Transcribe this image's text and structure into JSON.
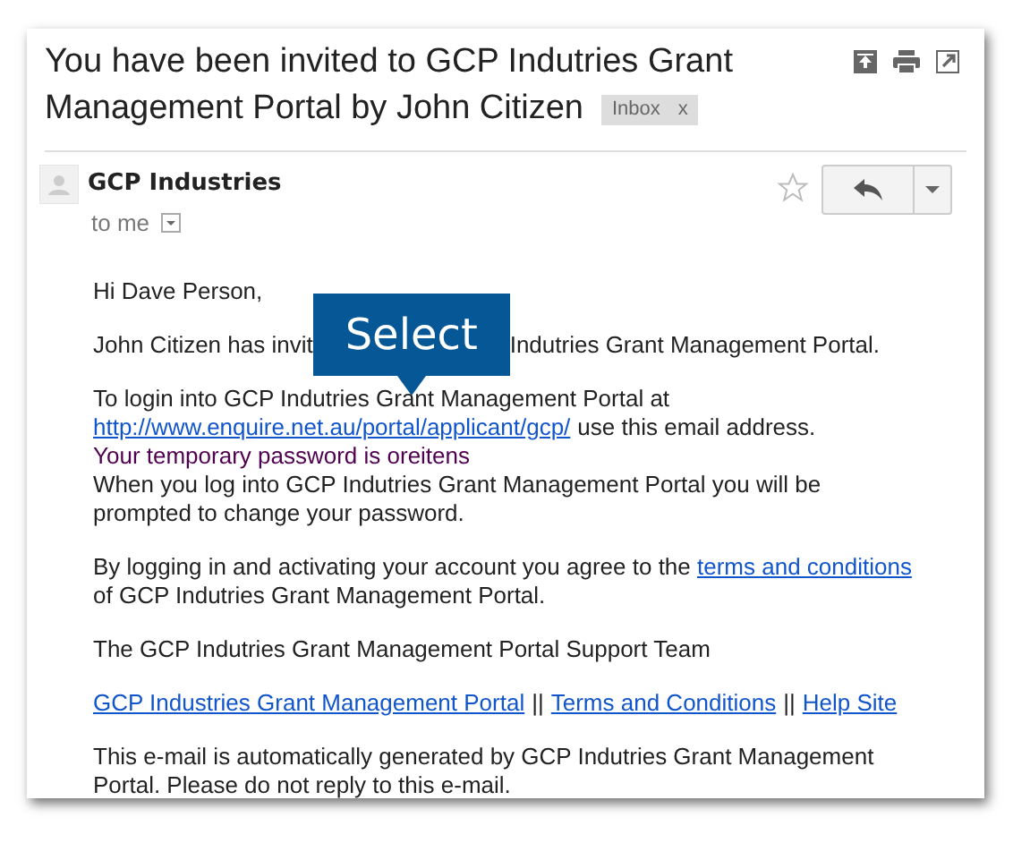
{
  "email": {
    "subject_lines": [
      "You have been invited to GCP Indutries Grant",
      "Management Portal by John Citizen"
    ],
    "label": {
      "text": "Inbox",
      "remove": "x"
    }
  },
  "sender": {
    "name": "GCP Industries",
    "recipient": "to me",
    "starred": false
  },
  "body": {
    "greeting": "Hi Dave Person,",
    "invite_visible": [
      "John Citizen has invit",
      "Indutries Grant Management Portal."
    ],
    "callout": "Select",
    "login_line": "To login into GCP Indutries Grant Management Portal at",
    "login_link": "http://www.enquire.net.au/portal/applicant/gcp/",
    "login_after": "use this email address.",
    "password": "Your temporary password is oreitens",
    "change": "When you log into GCP Indutries Grant Management Portal you will be prompted to change your password.",
    "agree": "By logging in and activating your account you agree to the",
    "agree_link": "terms and conditions",
    "agree_after": "of GCP Indutries Grant Management Portal.",
    "signature": "The GCP Indutries Grant Management Portal Support Team",
    "footer_links": [
      "GCP Industries Grant Management Portal",
      "Terms and Conditions",
      "Help Site"
    ],
    "footer_separators": [
      "||",
      "||"
    ],
    "disclaimer": "This e-mail is automatically generated by GCP Indutries Grant Management Portal. Please do not reply to this e-mail."
  }
}
